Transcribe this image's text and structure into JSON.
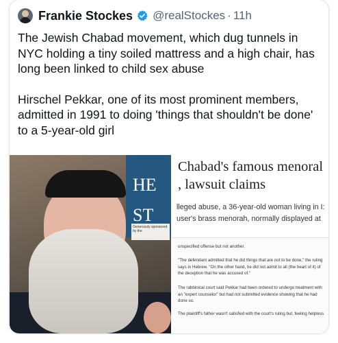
{
  "tweet": {
    "display_name": "Frankie Stockes",
    "handle": "@realStockes",
    "separator": "·",
    "time": "11h",
    "paragraphs": [
      "The Jewish Chabad movement, which dug tunnels in NYC holding a tiny soiled mattress and a high chair, has long been linked to child sex abuse",
      "Hirschel Pekkar, one of its most prominent members, admitted in 1991 to doing 'things that shouldn't be done' to a 5-year-old girl"
    ]
  },
  "media": {
    "photo_sign_text": "HE\nST",
    "sponsor_text": "Generously sponsored by the",
    "article": {
      "headline_line1": "Chabad's famous menoral",
      "headline_line2": ", lawsuit claims",
      "snippet_line1": "lleged abuse, a 36-year-old woman living in I:",
      "snippet_line2": "user's brass menorah, normally displayed at",
      "paragraphs": [
        "unspecified offense but not another.",
        "\"The defendant admitted that he did things that are not to be done,\" the ruling says in Hebrew. \"On the other hand, he did not admit to all (the heart of it) of the deception that he was accused of.\"",
        "The rabbinical court said Pekkar had been ordered to undergo treatment with an \"expert counselor\" but had not submitted evidence showing that he had done so.",
        "The plaintiff's father wasn't satisfied with the court's ruling but, feeling helpless"
      ]
    }
  },
  "colors": {
    "text": "#0f1419",
    "secondary": "#536471",
    "verified": "#1d9bf0"
  },
  "icons": [
    "avatar",
    "verified-badge-icon"
  ]
}
